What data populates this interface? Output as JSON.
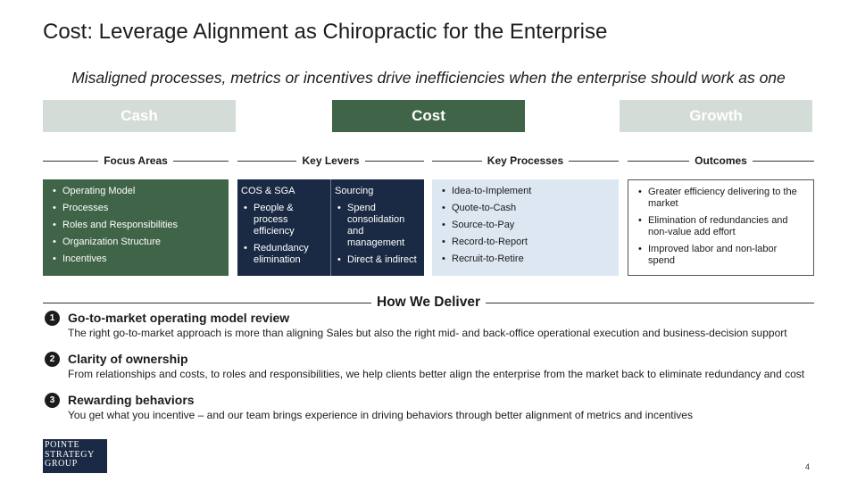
{
  "title": "Cost: Leverage Alignment as Chiropractic for the Enterprise",
  "subtitle": "Misaligned processes, metrics or incentives drive inefficiencies when the enterprise should work as one",
  "tabs": [
    "Cash",
    "Cost",
    "Growth"
  ],
  "columns": {
    "focus": {
      "heading": "Focus Areas",
      "items": [
        "Operating Model",
        "Processes",
        "Roles and Responsibilities",
        "Organization Structure",
        "Incentives"
      ]
    },
    "levers": {
      "heading": "Key Levers",
      "groups": [
        {
          "title": "COS & SGA",
          "items": [
            "People & process efficiency",
            "Redundancy elimination"
          ]
        },
        {
          "title": "Sourcing",
          "items": [
            "Spend consolidation and management",
            "Direct & indirect"
          ]
        }
      ]
    },
    "processes": {
      "heading": "Key Processes",
      "items": [
        "Idea-to-Implement",
        "Quote-to-Cash",
        "Source-to-Pay",
        "Record-to-Report",
        "Recruit-to-Retire"
      ]
    },
    "outcomes": {
      "heading": "Outcomes",
      "items": [
        "Greater efficiency delivering to the market",
        "Elimination of redundancies and non-value add effort",
        "Improved labor and non-labor spend"
      ]
    }
  },
  "deliver": {
    "heading": "How We Deliver",
    "items": [
      {
        "num": "1",
        "title": "Go-to-market operating model review",
        "desc": "The right go-to-market approach is more than aligning Sales but also the right mid- and back-office operational execution and business-decision support"
      },
      {
        "num": "2",
        "title": "Clarity of ownership",
        "desc": "From relationships and costs, to roles and responsibilities, we help clients better align the enterprise from the market back to eliminate redundancy and cost"
      },
      {
        "num": "3",
        "title": "Rewarding behaviors",
        "desc": "You get what you incentive – and our team brings experience in driving behaviors through better alignment of metrics and incentives"
      }
    ]
  },
  "logo_lines": [
    "POINTE",
    "STRATEGY",
    "GROUP"
  ],
  "page_number": "4",
  "colors": {
    "green": "#3f6447",
    "light_green": "#d3dcd6",
    "navy": "#1b2a44",
    "light_blue": "#dce7f2"
  }
}
